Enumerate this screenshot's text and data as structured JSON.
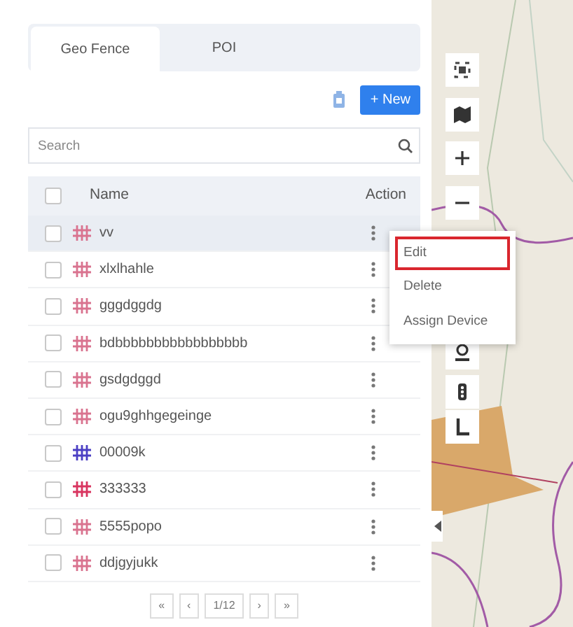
{
  "tabs": [
    {
      "label": "Geo Fence",
      "selected": true
    },
    {
      "label": "POI",
      "selected": false
    }
  ],
  "toolbar": {
    "new_button": "+ New"
  },
  "search": {
    "placeholder": "Search"
  },
  "table": {
    "columns": [
      "Name",
      "Action"
    ],
    "header_checked": false,
    "rows": [
      {
        "name": "vv",
        "color": "#d9738f",
        "checked": false,
        "hovered": true
      },
      {
        "name": "xlxlhahle",
        "color": "#d9738f",
        "checked": false,
        "hovered": false
      },
      {
        "name": "gggdggdg",
        "color": "#d9738f",
        "checked": false,
        "hovered": false
      },
      {
        "name": "bdbbbbbbbbbbbbbbbbb",
        "color": "#d9738f",
        "checked": false,
        "hovered": false
      },
      {
        "name": "gsdgdggd",
        "color": "#d9738f",
        "checked": false,
        "hovered": false
      },
      {
        "name": "ogu9ghhgegeinge",
        "color": "#d9738f",
        "checked": false,
        "hovered": false
      },
      {
        "name": "00009k",
        "color": "#4b3fc4",
        "checked": false,
        "hovered": false
      },
      {
        "name": "333333",
        "color": "#d8345f",
        "checked": false,
        "hovered": false
      },
      {
        "name": "5555popo",
        "color": "#d9738f",
        "checked": false,
        "hovered": false
      },
      {
        "name": "ddjgyjukk",
        "color": "#d9738f",
        "checked": false,
        "hovered": false
      }
    ]
  },
  "context_menu": [
    {
      "label": "Edit",
      "selected": true
    },
    {
      "label": "Delete",
      "selected": false
    },
    {
      "label": "Assign Device",
      "selected": false
    }
  ],
  "pagination": [
    "«",
    "‹",
    "1/12",
    "›",
    "»"
  ]
}
